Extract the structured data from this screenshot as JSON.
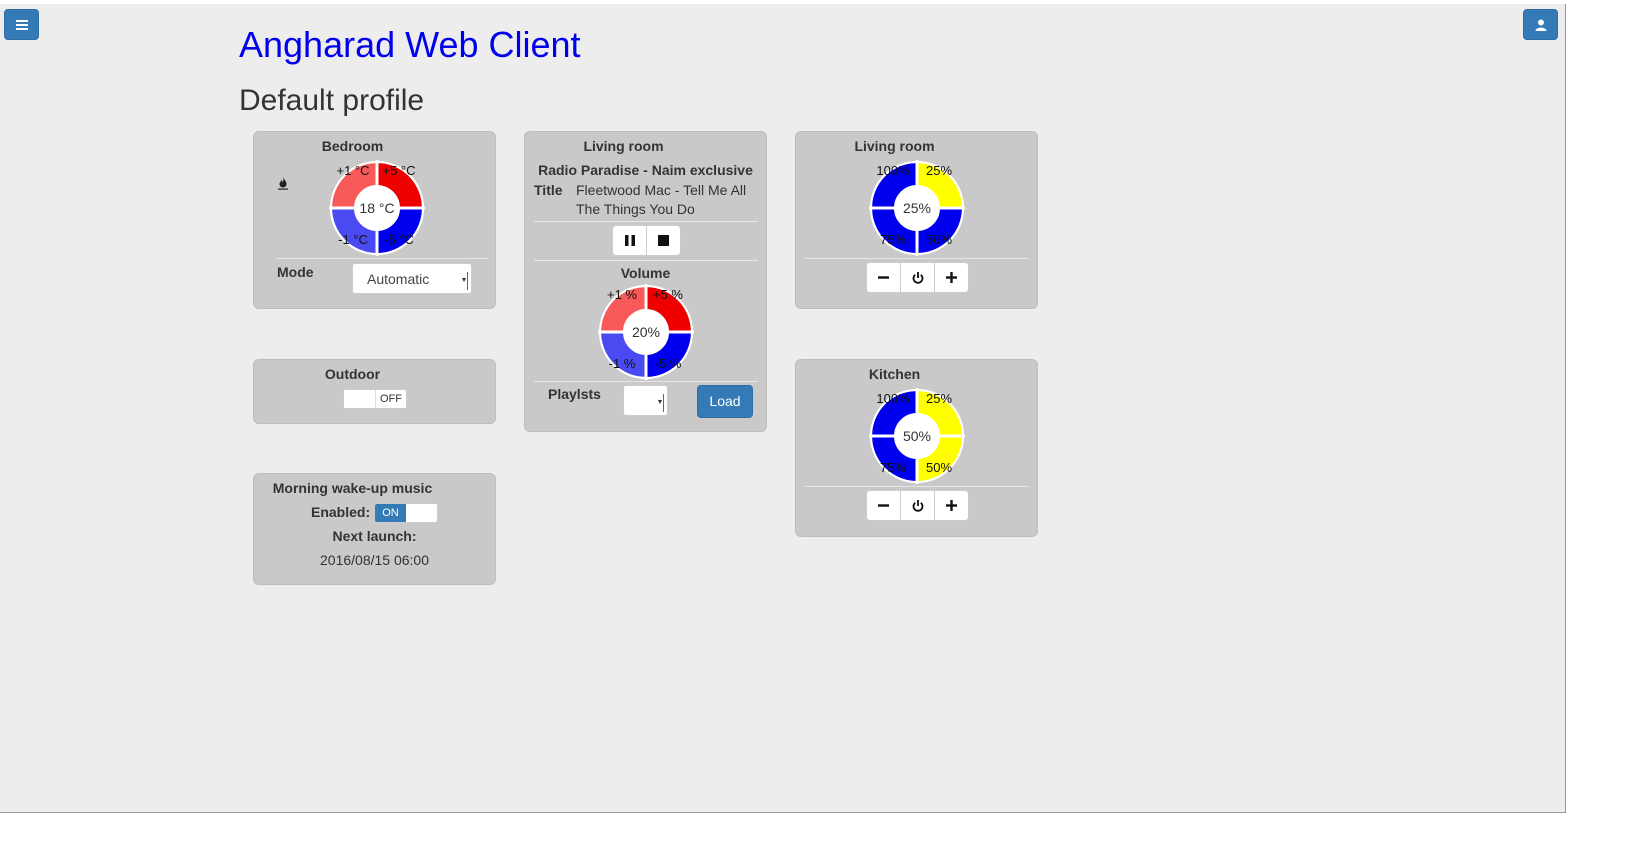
{
  "app": {
    "title": "Angharad Web Client"
  },
  "profile": {
    "title": "Default profile"
  },
  "toolbar": {
    "menu_icon": "hamburger-menu-icon",
    "user_icon": "user-icon"
  },
  "colors": {
    "accent": "#337ab7",
    "title_blue": "#0000ee",
    "panel_bg": "#c9c9c9",
    "plus_strong": "#ee0000",
    "plus_light": "#f85a5a",
    "minus_strong": "#0000ee",
    "minus_light": "#4a4af2",
    "dimmer_on": "#0000ee",
    "dimmer_off": "#ffff00"
  },
  "bedroom": {
    "title": "Bedroom",
    "icon": "flame-icon",
    "dial": {
      "center": "18 °C",
      "tl": "+1 °C",
      "tr": "+5 °C",
      "bl": "-1 °C",
      "br": "-5 °C"
    },
    "mode_label": "Mode",
    "mode_value": "Automatic"
  },
  "outdoor": {
    "title": "Outdoor",
    "switch_state": "OFF"
  },
  "wakeup": {
    "title": "Morning wake-up music",
    "enabled_label": "Enabled:",
    "enabled_state": "ON",
    "next_label": "Next launch:",
    "next_value": "2016/08/15 06:00"
  },
  "media": {
    "title": "Living room",
    "station": "Radio Paradise - Naim exclusive",
    "title_label": "Title",
    "track_line1": "Fleetwood Mac - Tell Me All",
    "track_line2": "The Things You Do",
    "pause_icon": "pause-icon",
    "stop_icon": "stop-icon",
    "volume_label": "Volume",
    "volume_dial": {
      "center": "20%",
      "tl": "+1 %",
      "tr": "+5 %",
      "bl": "-1 %",
      "br": "-5 %"
    },
    "playlists_label": "Playlsts",
    "playlists_value": "",
    "load_label": "Load"
  },
  "living_dimmer": {
    "title": "Living room",
    "level": 0.25,
    "dial": {
      "center": "25%",
      "tl": "100%",
      "tr": "25%",
      "bl": "75%",
      "br": "50%"
    }
  },
  "kitchen_dimmer": {
    "title": "Kitchen",
    "level": 0.5,
    "dial": {
      "center": "50%",
      "tl": "100%",
      "tr": "25%",
      "bl": "75%",
      "br": "50%"
    }
  },
  "dimmer_buttons": {
    "minus_icon": "minus-icon",
    "power_icon": "power-icon",
    "plus_icon": "plus-icon"
  }
}
